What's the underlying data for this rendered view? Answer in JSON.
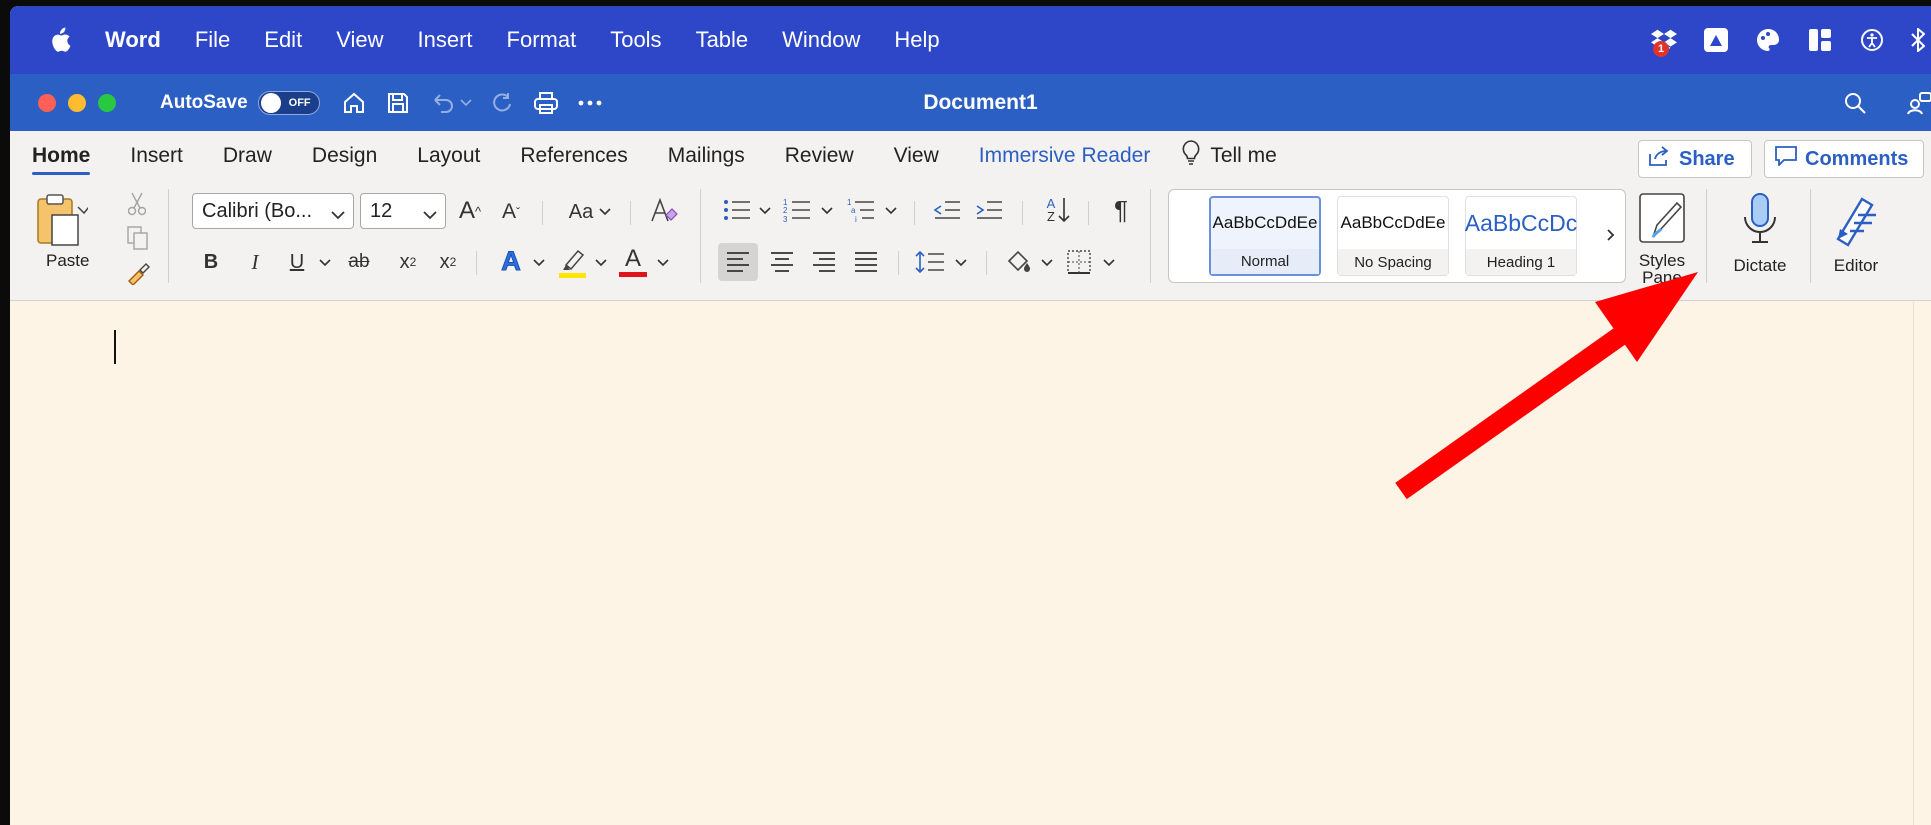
{
  "menubar": {
    "app": "Word",
    "items": [
      "File",
      "Edit",
      "View",
      "Insert",
      "Format",
      "Tools",
      "Table",
      "Window",
      "Help"
    ],
    "tray_badge": "1"
  },
  "titlebar": {
    "autosave_label": "AutoSave",
    "autosave_state": "OFF",
    "doc_title": "Document1"
  },
  "tabs": {
    "items": [
      "Home",
      "Insert",
      "Draw",
      "Design",
      "Layout",
      "References",
      "Mailings",
      "Review",
      "View",
      "Immersive Reader"
    ],
    "active": "Home",
    "tell_me": "Tell me",
    "share": "Share",
    "comments": "Comments"
  },
  "ribbon": {
    "paste_label": "Paste",
    "font_name": "Calibri (Bo...",
    "font_size": "12",
    "grow_font": "A",
    "shrink_font": "A",
    "change_case": "Aa",
    "bold": "B",
    "italic": "I",
    "underline": "U",
    "strike": "ab",
    "subscript": "x",
    "superscript": "x",
    "sub_mark": "2",
    "sup_mark": "2",
    "text_effects": "A",
    "font_color": "A",
    "sort": "A",
    "sort_z": "Z",
    "pilcrow": "¶",
    "styles": [
      {
        "sample": "AaBbCcDdEe",
        "name": "Normal",
        "selected": true
      },
      {
        "sample": "AaBbCcDdEe",
        "name": "No Spacing",
        "selected": false
      },
      {
        "sample": "AaBbCcDc",
        "name": "Heading 1",
        "selected": false
      }
    ],
    "styles_pane": [
      "Styles",
      "Pane"
    ],
    "dictate": "Dictate",
    "editor": "Editor"
  },
  "colors": {
    "menubar": "#2d47c8",
    "titlebar": "#2b5fc3",
    "accent": "#2b5fc3",
    "doc_bg": "#fdf4e6",
    "annotation_arrow": "#ff0000"
  }
}
